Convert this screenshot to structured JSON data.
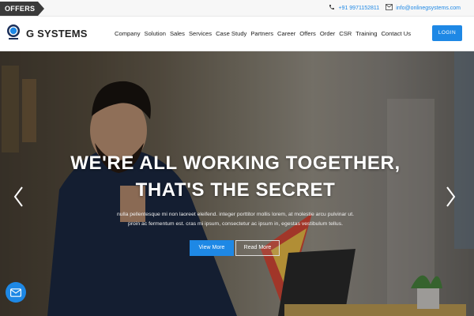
{
  "topbar": {
    "offers_label": "OFFERS",
    "phone": "+91 9971152811",
    "email": "info@onlinegsystems.com"
  },
  "header": {
    "brand": "G SYSTEMS",
    "nav": [
      "Company",
      "Solution",
      "Sales",
      "Services",
      "Case Study",
      "Partners",
      "Career",
      "Offers",
      "Order",
      "CSR",
      "Training",
      "Contact Us"
    ],
    "login_label": "LOGIN"
  },
  "hero": {
    "title_line1": "WE'RE ALL WORKING TOGETHER,",
    "title_line2": "THAT'S THE SECRET",
    "text_line1": "nulla pellentesque mi non laoreet eleifend. integer porttitor mollis lorem, at molestie arcu pulvinar ut.",
    "text_line2": "proin ac fermentum est. cras mi ipsum, consectetur ac ipsum in, egestas vestibulum tellus.",
    "primary_button": "View More",
    "secondary_button": "Read More"
  },
  "colors": {
    "accent": "#1e88e5",
    "dark": "#222222"
  },
  "icons": {
    "phone": "phone-icon",
    "email": "envelope-icon",
    "prev": "chevron-left-icon",
    "next": "chevron-right-icon",
    "fab": "mail-icon"
  }
}
